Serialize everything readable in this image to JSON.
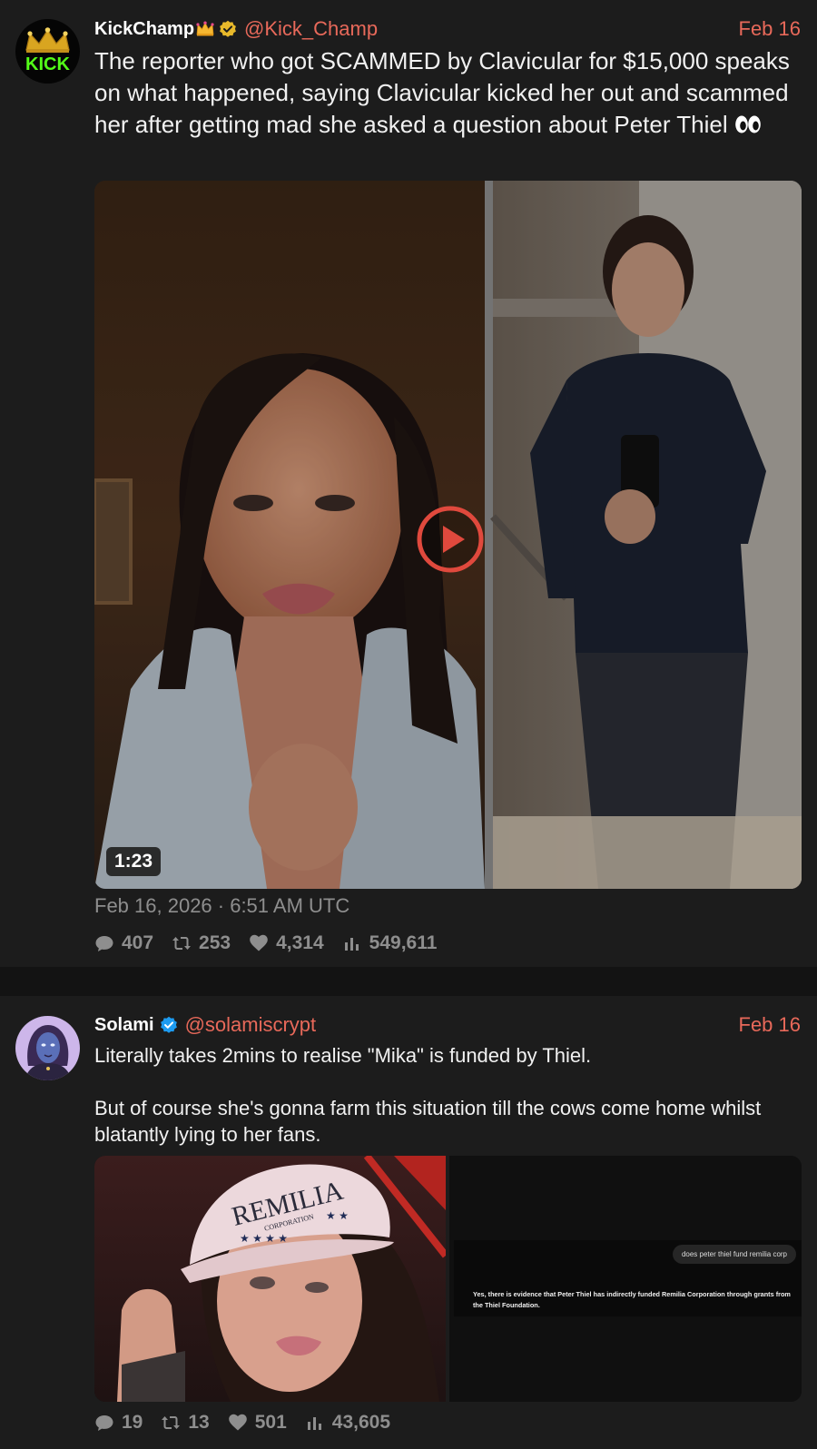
{
  "tweets": [
    {
      "author": {
        "name": "KickChamp",
        "handle": "@Kick_Champ",
        "avatar_text": "KICK",
        "verified": "gold-check"
      },
      "date": "Feb 16",
      "text": "The reporter who got SCAMMED by Clavicular for $15,000 speaks on what happened, saying Clavicular kicked her out and scammed her after getting mad she asked a question about Peter Thiel",
      "media": {
        "type": "video",
        "duration": "1:23"
      },
      "timestamp": "Feb 16, 2026 · 6:51 AM UTC",
      "stats": {
        "replies": "407",
        "retweets": "253",
        "likes": "4,314",
        "views": "549,611"
      }
    },
    {
      "author": {
        "name": "Solami",
        "handle": "@solamiscrypt",
        "verified": "blue-check"
      },
      "date": "Feb 16",
      "text_paragraphs": [
        "Literally takes 2mins to realise \"Mika\" is funded by Thiel.",
        "But of course she's gonna farm this situation till the cows come home whilst blatantly lying to her fans."
      ],
      "media": {
        "type": "images",
        "hat_text": "REMILIA",
        "hat_subtext": "CORPORATION",
        "chat_question": "does peter thiel fund remilia corp",
        "chat_answer": "Yes, there is evidence that Peter Thiel has indirectly funded Remilia Corporation through grants from the Thiel Foundation."
      },
      "stats": {
        "replies": "19",
        "retweets": "13",
        "likes": "501",
        "views": "43,605"
      }
    }
  ],
  "colors": {
    "accent": "#e8695a",
    "background": "#1c1c1c",
    "muted": "#8e8e8e"
  }
}
